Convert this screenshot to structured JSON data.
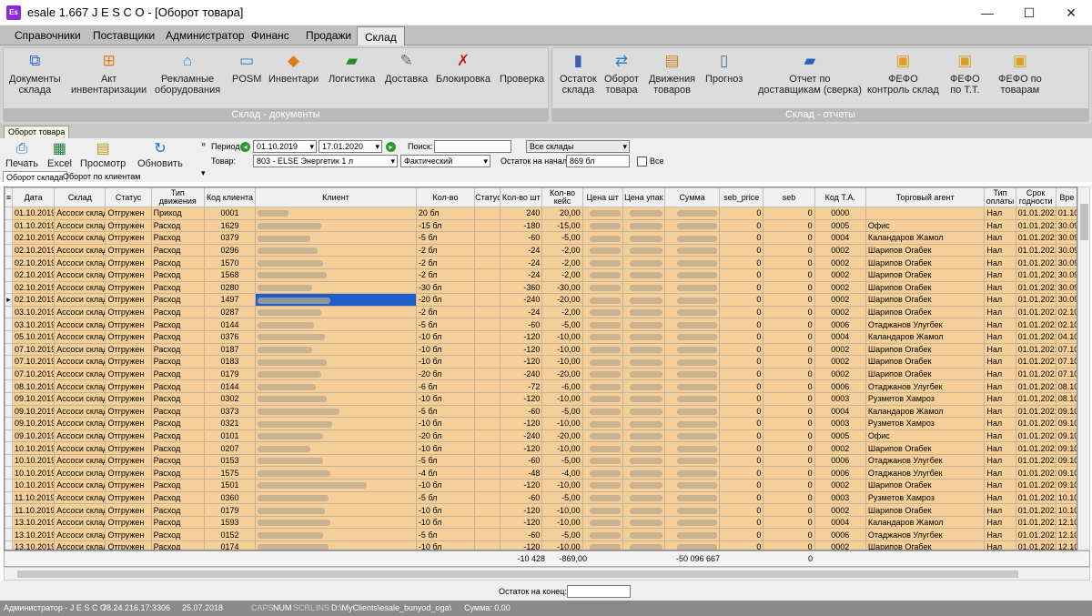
{
  "window": {
    "app_icon_text": "Es",
    "title": "esale 1.667   J E S C O - [Оборот товара]",
    "minimize": "—",
    "maximize": "☐",
    "close": "✕"
  },
  "menu": [
    "Справочники",
    "Поставщики",
    "Администратор",
    "Финанс",
    "Продажи",
    "Склад"
  ],
  "ribbon": {
    "group_docs_label": "Склад - документы",
    "group_reports_label": "Склад - отчеты",
    "docs_buttons": [
      {
        "label": "Документы\nсклада",
        "icon": "documents-icon"
      },
      {
        "label": "Акт\nинвентаризации",
        "icon": "inventory-act-icon"
      },
      {
        "label": "Рекламные\nоборудования",
        "icon": "advertising-equipment-icon"
      },
      {
        "label": "POSM",
        "icon": "posm-icon"
      },
      {
        "label": "Инвентари",
        "icon": "inventory-icon"
      },
      {
        "label": "Логистика",
        "icon": "truck-icon"
      },
      {
        "label": "Доставка",
        "icon": "delivery-icon"
      },
      {
        "label": "Блокировка",
        "icon": "block-icon"
      },
      {
        "label": "Проверка",
        "icon": "check-icon"
      }
    ],
    "reports_buttons": [
      {
        "label": "Остаток\nсклада",
        "icon": "stock-balance-icon"
      },
      {
        "label": "Оборот\nтовара",
        "icon": "turnover-icon"
      },
      {
        "label": "Движения\nтоваров",
        "icon": "movements-icon"
      },
      {
        "label": "Прогноз",
        "icon": "forecast-icon"
      },
      {
        "label": "Отчет по\nдоставщикам (сверка)",
        "icon": "car-report-icon"
      },
      {
        "label": "ФЕФО\nконтроль склад",
        "icon": "fefo-stock-icon"
      },
      {
        "label": "ФЕФО\nпо Т.Т.",
        "icon": "fefo-tt-icon"
      },
      {
        "label": "ФЕФО по\nтоварам",
        "icon": "fefo-goods-icon"
      }
    ]
  },
  "doc_tab": "Оборот товара",
  "toolbar": {
    "print": "Печать",
    "excel": "Excel",
    "view": "Просмотр",
    "refresh": "Обновить",
    "period_label": "Период:",
    "date_from": "01.10.2019",
    "date_to": "17.01.2020",
    "search_label": "Поиск:",
    "search_value": "",
    "warehouse_value": "Все склады",
    "product_label": "Товар:",
    "product_value": "803 - ELSE Энергетик 1 л",
    "mode_value": "Фактический",
    "start_balance_label": "Остаток на начало:",
    "start_balance_value": "869 бл",
    "all_label": "Все"
  },
  "subtabs": [
    "Оборот склада",
    "Оборот по клиентам"
  ],
  "columns": [
    "Дата",
    "Склад",
    "Статус",
    "Тип движения",
    "Код клиента",
    "Клиент",
    "Кол-во",
    "Статус",
    "Кол-во шт",
    "Кол-во кейс",
    "Цена шт",
    "Цена упак",
    "Сумма",
    "seb_price",
    "seb",
    "Код Т.А.",
    "Торговый агент",
    "Тип оплаты",
    "Срок годности",
    "Вре"
  ],
  "rows": [
    {
      "date": "01.10.2019",
      "wh": "Ассоси склад",
      "status": "Отгружен",
      "type": "Приход",
      "code": "0001",
      "qty": "20 бл",
      "pcs": "240",
      "cases": "20,00",
      "seb_price": "0",
      "seb": "0",
      "ta": "0000",
      "agent": "",
      "pay": "Нал",
      "exp": "01.01.2021",
      "time": "01.10.2"
    },
    {
      "date": "01.10.2019",
      "wh": "Ассоси склад",
      "status": "Отгружен",
      "type": "Расход",
      "code": "1629",
      "qty": "-15 бл",
      "pcs": "-180",
      "cases": "-15,00",
      "seb_price": "0",
      "seb": "0",
      "ta": "0005",
      "agent": "Офис",
      "pay": "Нал",
      "exp": "01.01.2021",
      "time": "30.09.2"
    },
    {
      "date": "02.10.2019",
      "wh": "Ассоси склад",
      "status": "Отгружен",
      "type": "Расход",
      "code": "0379",
      "qty": "-5 бл",
      "pcs": "-60",
      "cases": "-5,00",
      "seb_price": "0",
      "seb": "0",
      "ta": "0004",
      "agent": "Каландаров Жамол",
      "pay": "Нал",
      "exp": "01.01.2021",
      "time": "30.09.2"
    },
    {
      "date": "02.10.2019",
      "wh": "Ассоси склад",
      "status": "Отгружен",
      "type": "Расход",
      "code": "0296",
      "qty": "-2 бл",
      "pcs": "-24",
      "cases": "-2,00",
      "seb_price": "0",
      "seb": "0",
      "ta": "0002",
      "agent": "Шарипов Огабек",
      "pay": "Нал",
      "exp": "01.01.2021",
      "time": "30.09.2"
    },
    {
      "date": "02.10.2019",
      "wh": "Ассоси склад",
      "status": "Отгружен",
      "type": "Расход",
      "code": "1570",
      "qty": "-2 бл",
      "pcs": "-24",
      "cases": "-2,00",
      "seb_price": "0",
      "seb": "0",
      "ta": "0002",
      "agent": "Шарипов Огабек",
      "pay": "Нал",
      "exp": "01.01.2021",
      "time": "30.09.2"
    },
    {
      "date": "02.10.2019",
      "wh": "Ассоси склад",
      "status": "Отгружен",
      "type": "Расход",
      "code": "1568",
      "qty": "-2 бл",
      "pcs": "-24",
      "cases": "-2,00",
      "seb_price": "0",
      "seb": "0",
      "ta": "0002",
      "agent": "Шарипов Огабек",
      "pay": "Нал",
      "exp": "01.01.2021",
      "time": "30.09.2"
    },
    {
      "date": "02.10.2019",
      "wh": "Ассоси склад",
      "status": "Отгружен",
      "type": "Расход",
      "code": "0280",
      "qty": "-30 бл",
      "pcs": "-360",
      "cases": "-30,00",
      "seb_price": "0",
      "seb": "0",
      "ta": "0002",
      "agent": "Шарипов Огабек",
      "pay": "Нал",
      "exp": "01.01.2021",
      "time": "30.09.2"
    },
    {
      "date": "02.10.2019",
      "wh": "Ассоси склад",
      "status": "Отгружен",
      "type": "Расход",
      "code": "1497",
      "qty": "-20 бл",
      "pcs": "-240",
      "cases": "-20,00",
      "seb_price": "0",
      "seb": "0",
      "ta": "0002",
      "agent": "Шарипов Огабек",
      "pay": "Нал",
      "exp": "01.01.2021",
      "time": "30.09.2",
      "selected": true
    },
    {
      "date": "03.10.2019",
      "wh": "Ассоси склад",
      "status": "Отгружен",
      "type": "Расход",
      "code": "0287",
      "qty": "-2 бл",
      "pcs": "-24",
      "cases": "-2,00",
      "seb_price": "0",
      "seb": "0",
      "ta": "0002",
      "agent": "Шарипов Огабек",
      "pay": "Нал",
      "exp": "01.01.2021",
      "time": "02.10.2"
    },
    {
      "date": "03.10.2019",
      "wh": "Ассоси склад",
      "status": "Отгружен",
      "type": "Расход",
      "code": "0144",
      "qty": "-5 бл",
      "pcs": "-60",
      "cases": "-5,00",
      "seb_price": "0",
      "seb": "0",
      "ta": "0006",
      "agent": "Отаджанов Улугбек",
      "pay": "Нал",
      "exp": "01.01.2021",
      "time": "02.10.2"
    },
    {
      "date": "05.10.2019",
      "wh": "Ассоси склад",
      "status": "Отгружен",
      "type": "Расход",
      "code": "0376",
      "qty": "-10 бл",
      "pcs": "-120",
      "cases": "-10,00",
      "seb_price": "0",
      "seb": "0",
      "ta": "0004",
      "agent": "Каландаров Жамол",
      "pay": "Нал",
      "exp": "01.01.2021",
      "time": "04.10.2"
    },
    {
      "date": "07.10.2019",
      "wh": "Ассоси склад",
      "status": "Отгружен",
      "type": "Расход",
      "code": "0187",
      "qty": "-10 бл",
      "pcs": "-120",
      "cases": "-10,00",
      "seb_price": "0",
      "seb": "0",
      "ta": "0002",
      "agent": "Шарипов Огабек",
      "pay": "Нал",
      "exp": "01.01.2021",
      "time": "07.10.2"
    },
    {
      "date": "07.10.2019",
      "wh": "Ассоси склад",
      "status": "Отгружен",
      "type": "Расход",
      "code": "0183",
      "qty": "-10 бл",
      "pcs": "-120",
      "cases": "-10,00",
      "seb_price": "0",
      "seb": "0",
      "ta": "0002",
      "agent": "Шарипов Огабек",
      "pay": "Нал",
      "exp": "01.01.2021",
      "time": "07.10.2"
    },
    {
      "date": "07.10.2019",
      "wh": "Ассоси склад",
      "status": "Отгружен",
      "type": "Расход",
      "code": "0179",
      "qty": "-20 бл",
      "pcs": "-240",
      "cases": "-20,00",
      "seb_price": "0",
      "seb": "0",
      "ta": "0002",
      "agent": "Шарипов Огабек",
      "pay": "Нал",
      "exp": "01.01.2021",
      "time": "07.10.2"
    },
    {
      "date": "08.10.2019",
      "wh": "Ассоси склад",
      "status": "Отгружен",
      "type": "Расход",
      "code": "0144",
      "qty": "-6 бл",
      "pcs": "-72",
      "cases": "-6,00",
      "seb_price": "0",
      "seb": "0",
      "ta": "0006",
      "agent": "Отаджанов Улугбек",
      "pay": "Нал",
      "exp": "01.01.2021",
      "time": "08.10.2"
    },
    {
      "date": "09.10.2019",
      "wh": "Ассоси склад",
      "status": "Отгружен",
      "type": "Расход",
      "code": "0302",
      "qty": "-10 бл",
      "pcs": "-120",
      "cases": "-10,00",
      "seb_price": "0",
      "seb": "0",
      "ta": "0003",
      "agent": "Рузметов Хамроз",
      "pay": "Нал",
      "exp": "01.01.2021",
      "time": "08.10.2"
    },
    {
      "date": "09.10.2019",
      "wh": "Ассоси склад",
      "status": "Отгружен",
      "type": "Расход",
      "code": "0373",
      "qty": "-5 бл",
      "pcs": "-60",
      "cases": "-5,00",
      "seb_price": "0",
      "seb": "0",
      "ta": "0004",
      "agent": "Каландаров Жамол",
      "pay": "Нал",
      "exp": "01.01.2021",
      "time": "09.10.2"
    },
    {
      "date": "09.10.2019",
      "wh": "Ассоси склад",
      "status": "Отгружен",
      "type": "Расход",
      "code": "0321",
      "qty": "-10 бл",
      "pcs": "-120",
      "cases": "-10,00",
      "seb_price": "0",
      "seb": "0",
      "ta": "0003",
      "agent": "Рузметов Хамроз",
      "pay": "Нал",
      "exp": "01.01.2021",
      "time": "09.10.2"
    },
    {
      "date": "09.10.2019",
      "wh": "Ассоси склад",
      "status": "Отгружен",
      "type": "Расход",
      "code": "0101",
      "qty": "-20 бл",
      "pcs": "-240",
      "cases": "-20,00",
      "seb_price": "0",
      "seb": "0",
      "ta": "0005",
      "agent": "Офис",
      "pay": "Нал",
      "exp": "01.01.2021",
      "time": "09.10.2"
    },
    {
      "date": "10.10.2019",
      "wh": "Ассоси склад",
      "status": "Отгружен",
      "type": "Расход",
      "code": "0207",
      "qty": "-10 бл",
      "pcs": "-120",
      "cases": "-10,00",
      "seb_price": "0",
      "seb": "0",
      "ta": "0002",
      "agent": "Шарипов Огабек",
      "pay": "Нал",
      "exp": "01.01.2021",
      "time": "09.10.2"
    },
    {
      "date": "10.10.2019",
      "wh": "Ассоси склад",
      "status": "Отгружен",
      "type": "Расход",
      "code": "0153",
      "qty": "-5 бл",
      "pcs": "-60",
      "cases": "-5,00",
      "seb_price": "0",
      "seb": "0",
      "ta": "0006",
      "agent": "Отаджанов Улугбек",
      "pay": "Нал",
      "exp": "01.01.2021",
      "time": "09.10.2"
    },
    {
      "date": "10.10.2019",
      "wh": "Ассоси склад",
      "status": "Отгружен",
      "type": "Расход",
      "code": "1575",
      "qty": "-4 бл",
      "pcs": "-48",
      "cases": "-4,00",
      "seb_price": "0",
      "seb": "0",
      "ta": "0006",
      "agent": "Отаджанов Улугбек",
      "pay": "Нал",
      "exp": "01.01.2021",
      "time": "09.10.2"
    },
    {
      "date": "10.10.2019",
      "wh": "Ассоси склад",
      "status": "Отгружен",
      "type": "Расход",
      "code": "1501",
      "qty": "-10 бл",
      "pcs": "-120",
      "cases": "-10,00",
      "seb_price": "0",
      "seb": "0",
      "ta": "0002",
      "agent": "Шарипов Огабек",
      "pay": "Нал",
      "exp": "01.01.2021",
      "time": "09.10.2"
    },
    {
      "date": "11.10.2019",
      "wh": "Ассоси склад",
      "status": "Отгружен",
      "type": "Расход",
      "code": "0360",
      "qty": "-5 бл",
      "pcs": "-60",
      "cases": "-5,00",
      "seb_price": "0",
      "seb": "0",
      "ta": "0003",
      "agent": "Рузметов Хамроз",
      "pay": "Нал",
      "exp": "01.01.2021",
      "time": "10.10.2"
    },
    {
      "date": "11.10.2019",
      "wh": "Ассоси склад",
      "status": "Отгружен",
      "type": "Расход",
      "code": "0179",
      "qty": "-10 бл",
      "pcs": "-120",
      "cases": "-10,00",
      "seb_price": "0",
      "seb": "0",
      "ta": "0002",
      "agent": "Шарипов Огабек",
      "pay": "Нал",
      "exp": "01.01.2021",
      "time": "10.10.2"
    },
    {
      "date": "13.10.2019",
      "wh": "Ассоси склад",
      "status": "Отгружен",
      "type": "Расход",
      "code": "1593",
      "qty": "-10 бл",
      "pcs": "-120",
      "cases": "-10,00",
      "seb_price": "0",
      "seb": "0",
      "ta": "0004",
      "agent": "Каландаров Жамол",
      "pay": "Нал",
      "exp": "01.01.2021",
      "time": "12.10.2"
    },
    {
      "date": "13.10.2019",
      "wh": "Ассоси склад",
      "status": "Отгружен",
      "type": "Расход",
      "code": "0152",
      "qty": "-5 бл",
      "pcs": "-60",
      "cases": "-5,00",
      "seb_price": "0",
      "seb": "0",
      "ta": "0006",
      "agent": "Отаджанов Улугбек",
      "pay": "Нал",
      "exp": "01.01.2021",
      "time": "12.10.2"
    },
    {
      "date": "13.10.2019",
      "wh": "Ассоси склад",
      "status": "Отгружен",
      "type": "Расход",
      "code": "0174",
      "qty": "-10 бл",
      "pcs": "-120",
      "cases": "-10,00",
      "seb_price": "0",
      "seb": "0",
      "ta": "0002",
      "agent": "Шарипов Огабек",
      "pay": "Нал",
      "exp": "01.01.2021",
      "time": "12.10.2"
    }
  ],
  "totals": {
    "pcs": "-10 428",
    "cases": "-869,00",
    "sum": "-50 096 667",
    "seb": "0"
  },
  "bottom": {
    "end_balance_label": "Остаток на конец:",
    "end_balance_value": ""
  },
  "statusbar": {
    "user": "Администратор - J E S C O",
    "server": "78.24.216.17:3306",
    "date": "25.07.2018",
    "caps": "CAPS",
    "num": "NUM",
    "scrl": "SCRL",
    "ins": "INS",
    "path": "D:\\MyClients\\esale_bunyod_oga\\",
    "sum": "Сумма: 0,00"
  },
  "colors": {
    "row_bg": "#f4cf9a",
    "selection": "#1e5ec8",
    "statusbar": "#8a8a8a"
  }
}
